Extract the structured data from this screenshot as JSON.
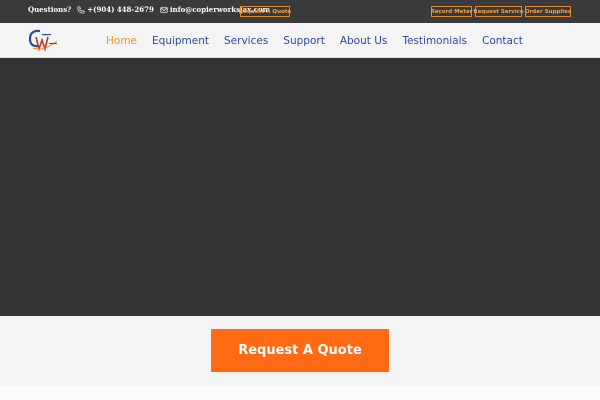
{
  "topbar": {
    "questions_label": "Questions?",
    "phone": "+(904) 448-2679",
    "email": "info@copierworksjax.com",
    "phone_icon": "phone-icon",
    "email_icon": "envelope-icon",
    "request_quote_label": "Request A Quote",
    "record_meter_label": "Record Meter",
    "request_service_label": "Request Service",
    "order_supplies_label": "Order Supplies"
  },
  "nav": {
    "items": [
      {
        "label": "Home"
      },
      {
        "label": "Equipment"
      },
      {
        "label": "Services"
      },
      {
        "label": "Support"
      },
      {
        "label": "About Us"
      },
      {
        "label": "Testimonials"
      },
      {
        "label": "Contact"
      }
    ],
    "active_index": 0
  },
  "cta": {
    "label": "Request A Quote"
  },
  "colors": {
    "topbar_bg": "#3a3a3a",
    "accent_orange": "#ff6a14",
    "nav_active": "#e8962a",
    "nav_link": "#2e4a9a",
    "hero_bg": "#333333"
  }
}
